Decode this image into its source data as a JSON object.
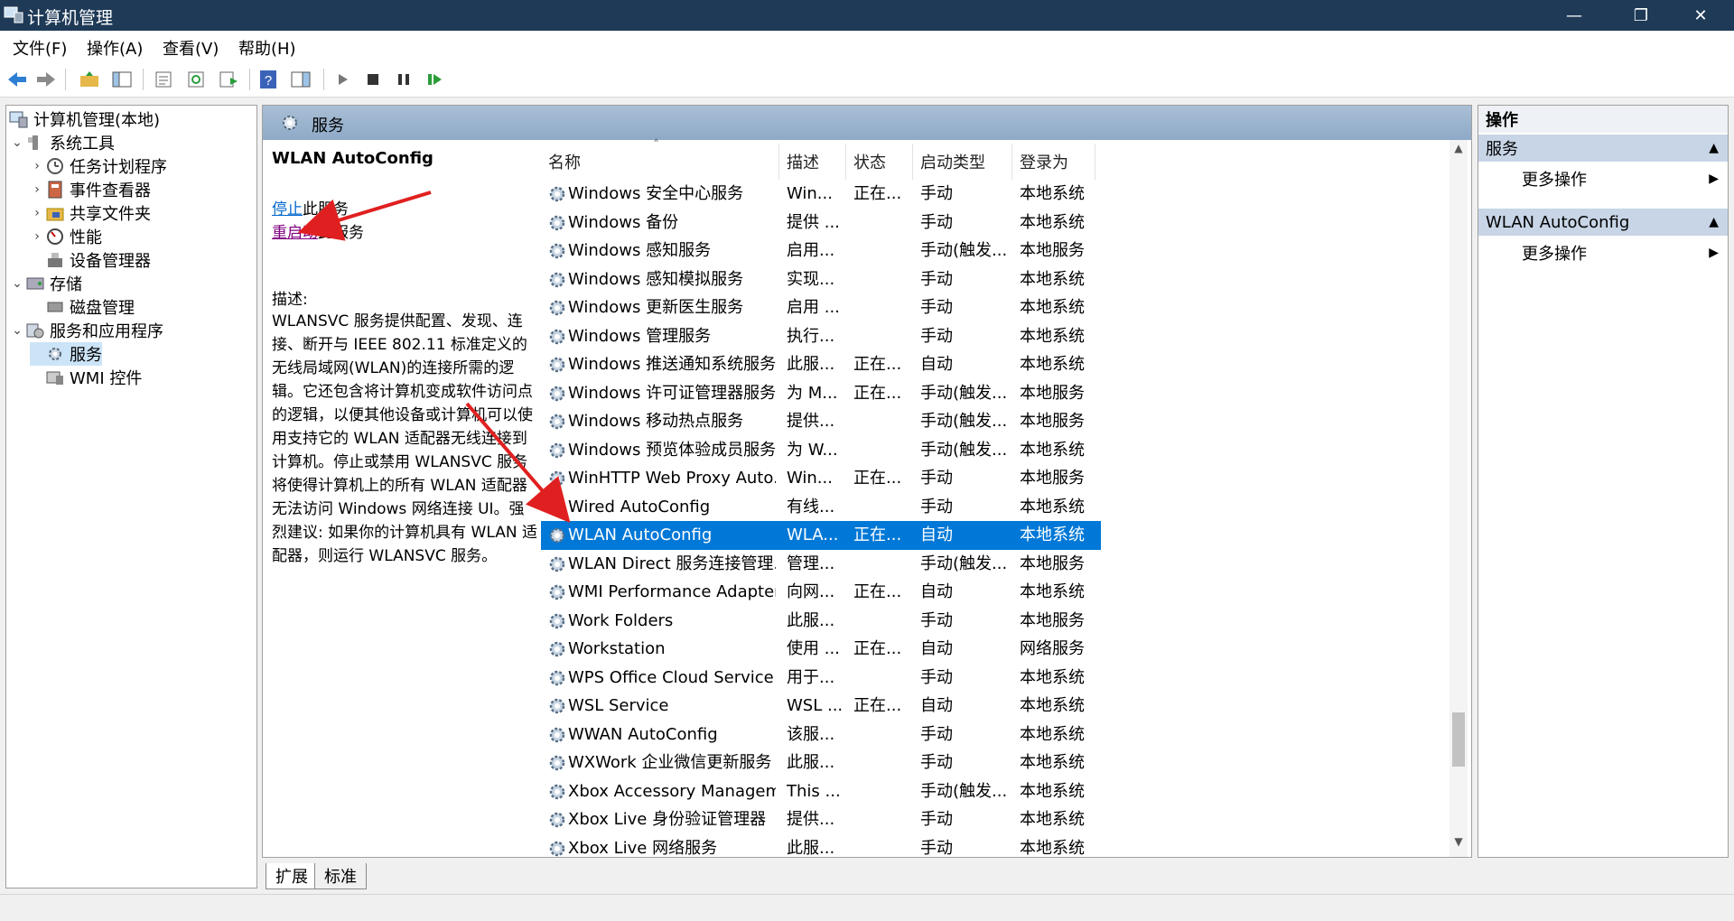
{
  "window": {
    "title": "计算机管理",
    "minimize": "—",
    "restore": "❐",
    "close": "✕"
  },
  "menu": [
    "文件(F)",
    "操作(A)",
    "查看(V)",
    "帮助(H)"
  ],
  "tree": [
    {
      "label": "计算机管理(本地)",
      "level": 0,
      "arrow": "",
      "icon": "computer-management-icon"
    },
    {
      "label": "系统工具",
      "level": 1,
      "arrow": "⌄",
      "icon": "system-tools-icon"
    },
    {
      "label": "任务计划程序",
      "level": 2,
      "arrow": "›",
      "icon": "task-scheduler-icon"
    },
    {
      "label": "事件查看器",
      "level": 2,
      "arrow": "›",
      "icon": "event-viewer-icon"
    },
    {
      "label": "共享文件夹",
      "level": 2,
      "arrow": "›",
      "icon": "shared-folders-icon"
    },
    {
      "label": "性能",
      "level": 2,
      "arrow": "›",
      "icon": "performance-icon"
    },
    {
      "label": "设备管理器",
      "level": 2,
      "arrow": "",
      "icon": "device-manager-icon"
    },
    {
      "label": "存储",
      "level": 1,
      "arrow": "⌄",
      "icon": "storage-icon"
    },
    {
      "label": "磁盘管理",
      "level": 2,
      "arrow": "",
      "icon": "disk-management-icon"
    },
    {
      "label": "服务和应用程序",
      "level": 1,
      "arrow": "⌄",
      "icon": "services-apps-icon"
    },
    {
      "label": "服务",
      "level": 2,
      "arrow": "",
      "icon": "services-icon",
      "selected": true
    },
    {
      "label": "WMI 控件",
      "level": 2,
      "arrow": "",
      "icon": "wmi-control-icon"
    }
  ],
  "center": {
    "header": "服务",
    "detail": {
      "title": "WLAN AutoConfig",
      "stop_link": "停止",
      "stop_suffix": "此服务",
      "restart_link": "重启动",
      "restart_suffix": "此服务",
      "desc_label": "描述:",
      "description": "WLANSVC 服务提供配置、发现、连接、断开与 IEEE 802.11 标准定义的无线局域网(WLAN)的连接所需的逻辑。它还包含将计算机变成软件访问点的逻辑，以便其他设备或计算机可以使用支持它的 WLAN 适配器无线连接到计算机。停止或禁用 WLANSVC 服务将使得计算机上的所有 WLAN 适配器无法访问 Windows 网络连接 UI。强烈建议: 如果你的计算机具有 WLAN 适配器，则运行 WLANSVC 服务。"
    },
    "columns": [
      "名称",
      "描述",
      "状态",
      "启动类型",
      "登录为"
    ],
    "sort_indicator": "˄",
    "rows": [
      [
        "Windows 安全中心服务",
        "Win...",
        "正在...",
        "手动",
        "本地系统"
      ],
      [
        "Windows 备份",
        "提供 ...",
        "",
        "手动",
        "本地系统"
      ],
      [
        "Windows 感知服务",
        "启用...",
        "",
        "手动(触发...",
        "本地服务"
      ],
      [
        "Windows 感知模拟服务",
        "实现...",
        "",
        "手动",
        "本地系统"
      ],
      [
        "Windows 更新医生服务",
        "启用 ...",
        "",
        "手动",
        "本地系统"
      ],
      [
        "Windows 管理服务",
        "执行...",
        "",
        "手动",
        "本地系统"
      ],
      [
        "Windows 推送通知系统服务",
        "此服...",
        "正在...",
        "自动",
        "本地系统"
      ],
      [
        "Windows 许可证管理器服务",
        "为 M...",
        "正在...",
        "手动(触发...",
        "本地服务"
      ],
      [
        "Windows 移动热点服务",
        "提供...",
        "",
        "手动(触发...",
        "本地服务"
      ],
      [
        "Windows 预览体验成员服务",
        "为 W...",
        "",
        "手动(触发...",
        "本地系统"
      ],
      [
        "WinHTTP Web Proxy Auto...",
        "Win...",
        "正在...",
        "手动",
        "本地服务"
      ],
      [
        "Wired AutoConfig",
        "有线...",
        "",
        "手动",
        "本地系统"
      ],
      [
        "WLAN AutoConfig",
        "WLA...",
        "正在...",
        "自动",
        "本地系统"
      ],
      [
        "WLAN Direct 服务连接管理...",
        "管理...",
        "",
        "手动(触发...",
        "本地服务"
      ],
      [
        "WMI Performance Adapter",
        "向网...",
        "正在...",
        "自动",
        "本地系统"
      ],
      [
        "Work Folders",
        "此服...",
        "",
        "手动",
        "本地服务"
      ],
      [
        "Workstation",
        "使用 ...",
        "正在...",
        "自动",
        "网络服务"
      ],
      [
        "WPS Office Cloud Service",
        "用于...",
        "",
        "手动",
        "本地系统"
      ],
      [
        "WSL Service",
        "WSL ...",
        "正在...",
        "自动",
        "本地系统"
      ],
      [
        "WWAN AutoConfig",
        "该服...",
        "",
        "手动",
        "本地系统"
      ],
      [
        "WXWork 企业微信更新服务",
        "此服...",
        "",
        "手动",
        "本地系统"
      ],
      [
        "Xbox Accessory Managem...",
        "This ...",
        "",
        "手动(触发...",
        "本地系统"
      ],
      [
        "Xbox Live 身份验证管理器",
        "提供...",
        "",
        "手动",
        "本地系统"
      ],
      [
        "Xbox Live 网络服务",
        "此服...",
        "",
        "手动",
        "本地系统"
      ]
    ],
    "selected_row": 12
  },
  "tabs": [
    "扩展",
    "标准"
  ],
  "actions": {
    "title": "操作",
    "groups": [
      {
        "header": "服务",
        "item": "更多操作"
      },
      {
        "header": "WLAN AutoConfig",
        "item": "更多操作"
      }
    ]
  },
  "colors": {
    "titlebar": "#1f3a57",
    "selection": "#0078d7",
    "annotation_arrow": "#e02020"
  }
}
